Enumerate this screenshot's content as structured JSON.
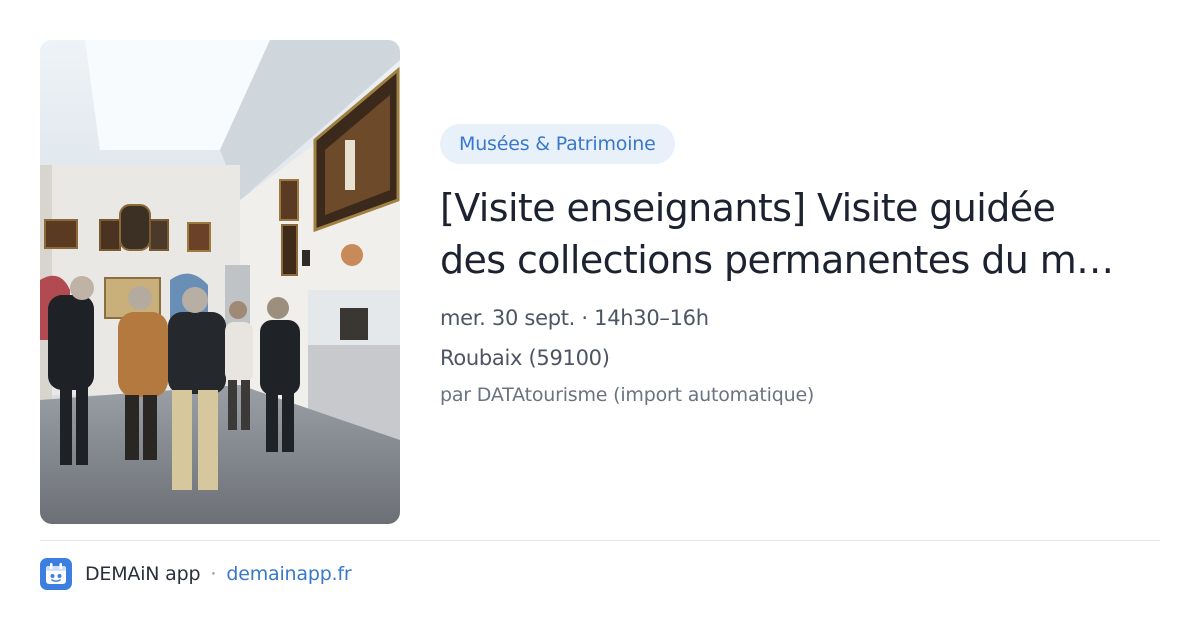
{
  "card": {
    "image_alt": "Visite guidée au musée",
    "category": "Musées & Patrimoine",
    "title_line1": "[Visite enseignants] Visite guidée",
    "title_line2": "des collections permanentes du m…",
    "date_time": "mer. 30 sept. · 14h30–16h",
    "location": "Roubaix (59100)",
    "source": "par DATAtourisme (import automatique)"
  },
  "footer": {
    "app_name": "DEMAiN app",
    "separator": "·",
    "domain": "demainapp.fr"
  },
  "colors": {
    "accent": "#3a78c9",
    "badge_bg": "#e8f0fa",
    "logo_bg": "#3d7fe0"
  },
  "icons": {
    "logo": "demain-app-logo-icon"
  }
}
